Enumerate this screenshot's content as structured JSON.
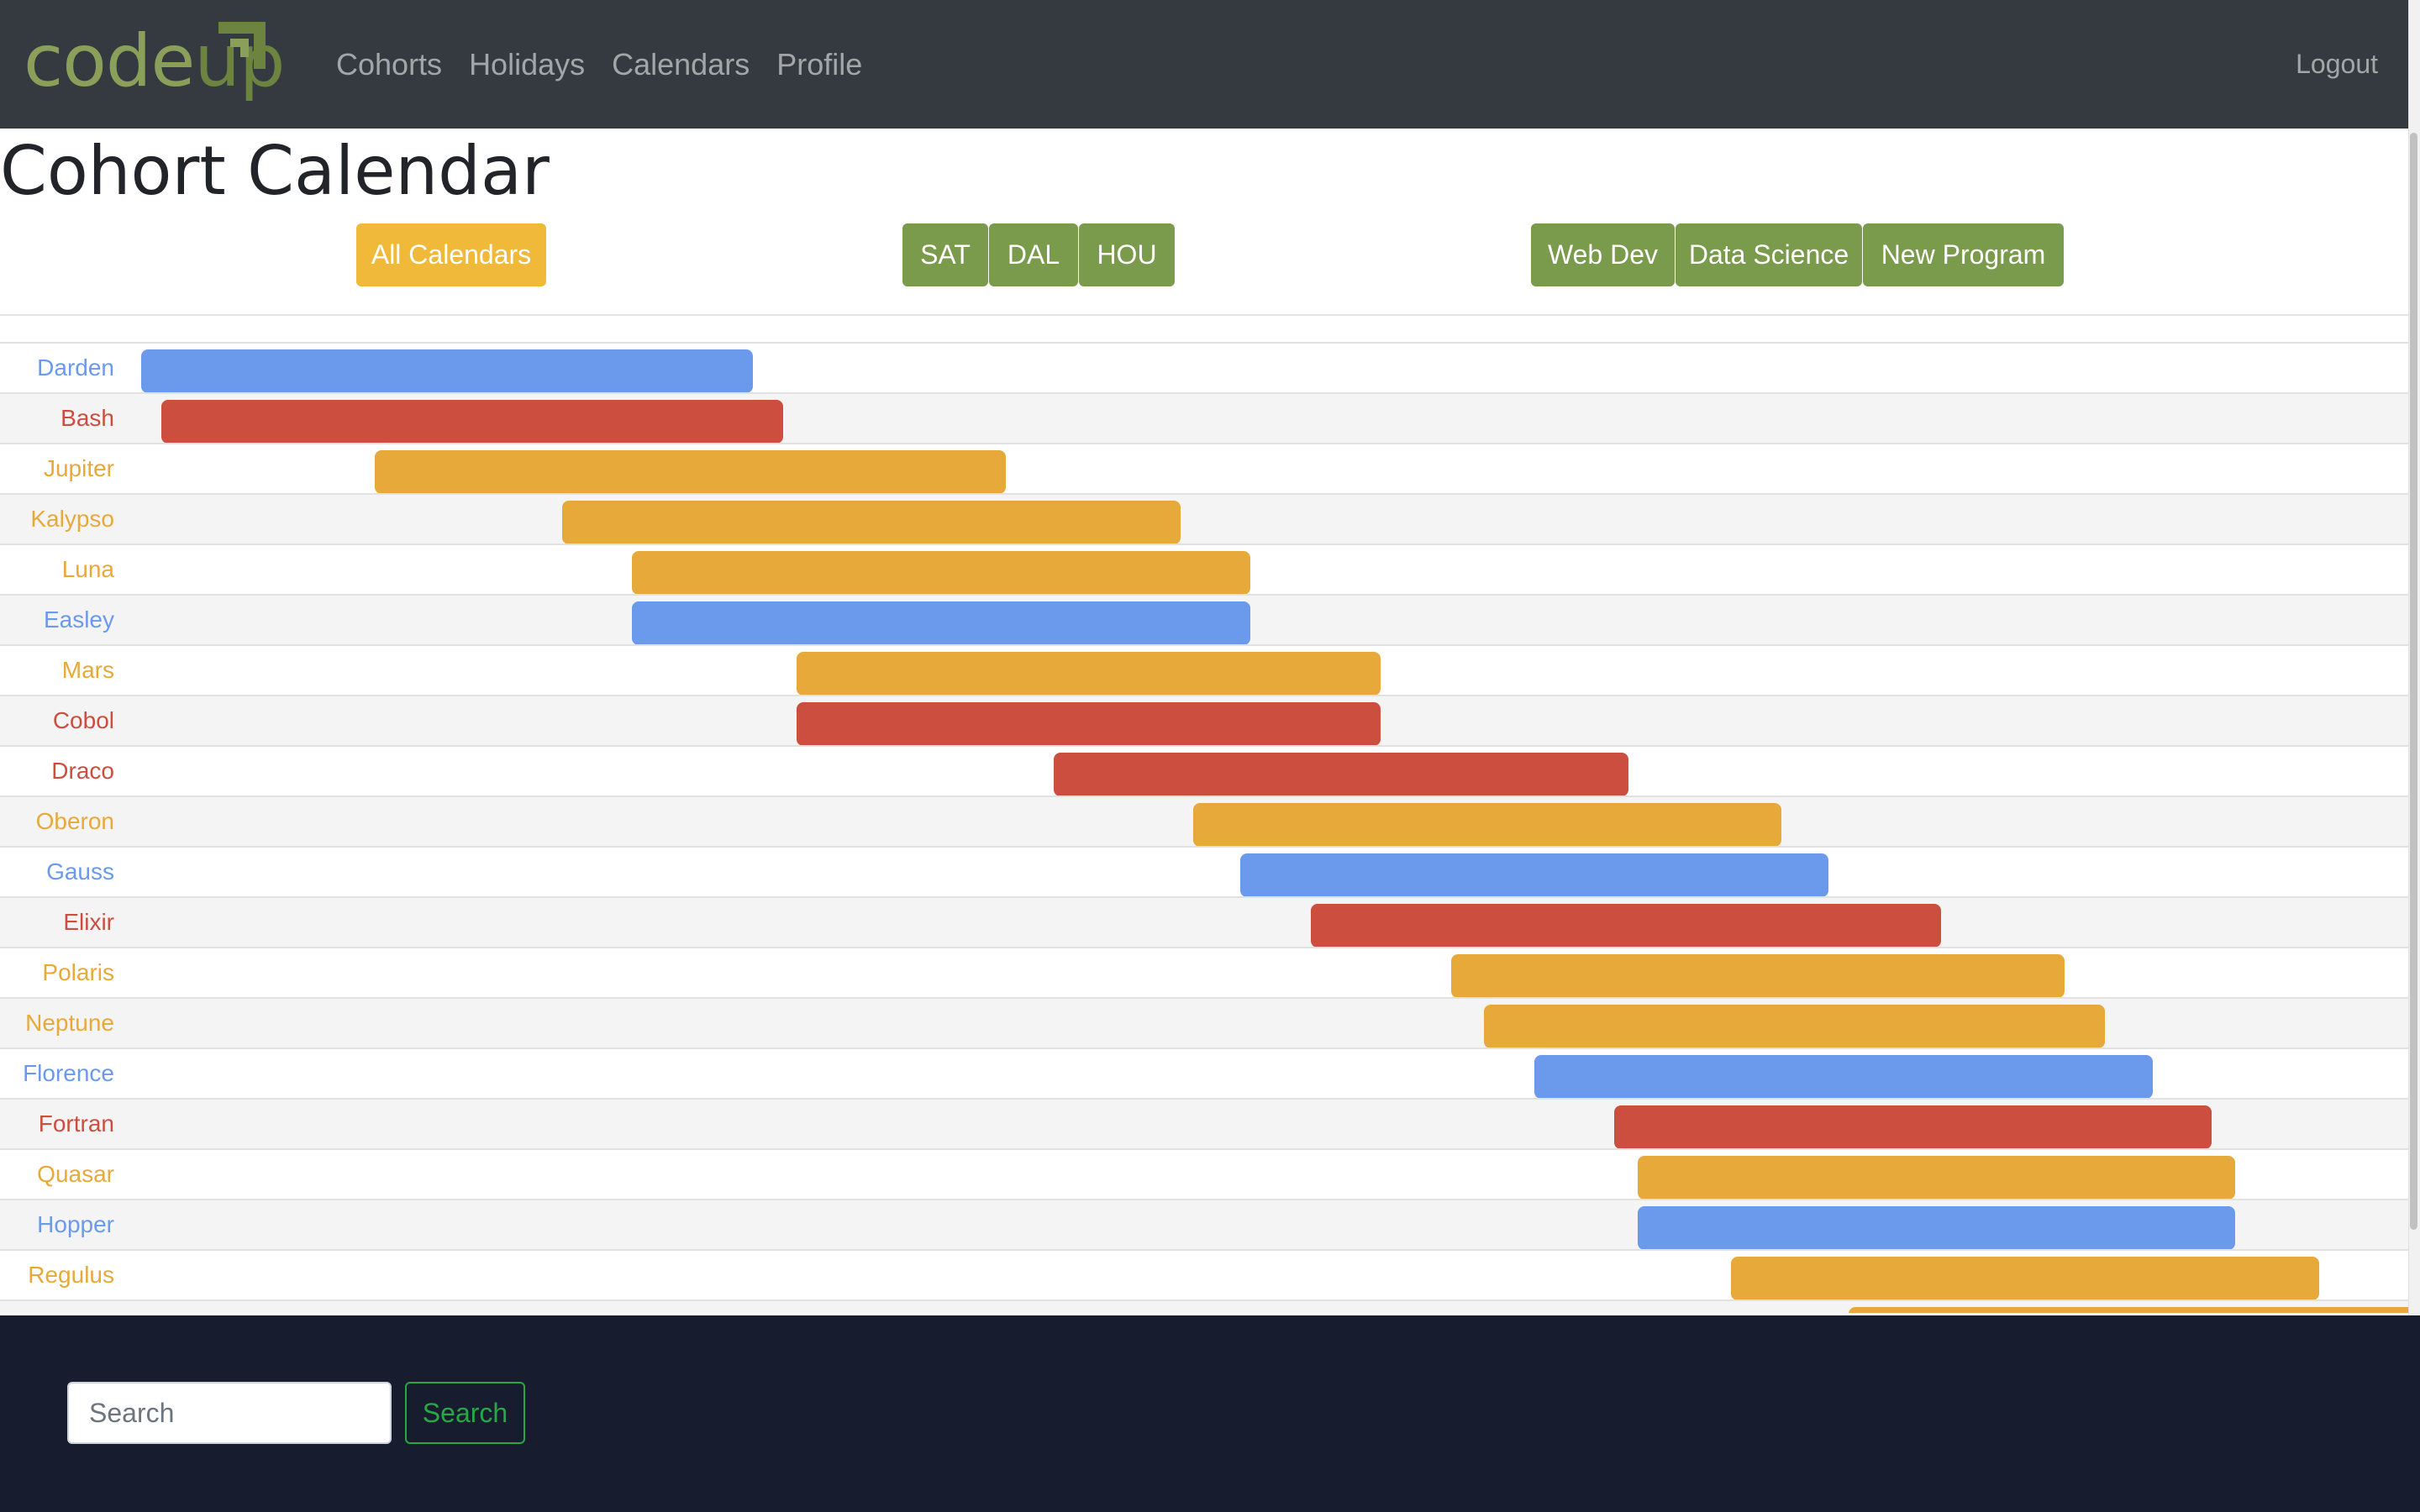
{
  "brand": {
    "part1": "code",
    "part2": "up"
  },
  "nav": {
    "links": [
      {
        "label": "Cohorts"
      },
      {
        "label": "Holidays"
      },
      {
        "label": "Calendars"
      },
      {
        "label": "Profile"
      }
    ],
    "logout": "Logout"
  },
  "page": {
    "title": "Cohort Calendar"
  },
  "filters": {
    "all_label": "All Calendars",
    "locations": [
      "SAT",
      "DAL",
      "HOU"
    ],
    "programs": [
      "Web Dev",
      "Data Science",
      "New Program"
    ]
  },
  "colors": {
    "blue": "#6b9aed",
    "red": "#cc4e3e",
    "gold": "#e8a93b",
    "nav_bg": "#343a40",
    "footer_bg": "#171c2e",
    "btn_gold": "#f0b93a",
    "btn_green": "#7a9a4c"
  },
  "calendar": {
    "cohorts": [
      {
        "name": "Darden",
        "color": "blue"
      },
      {
        "name": "Bash",
        "color": "red"
      },
      {
        "name": "Jupiter",
        "color": "gold"
      },
      {
        "name": "Kalypso",
        "color": "gold"
      },
      {
        "name": "Luna",
        "color": "gold"
      },
      {
        "name": "Easley",
        "color": "blue"
      },
      {
        "name": "Mars",
        "color": "gold"
      },
      {
        "name": "Cobol",
        "color": "red"
      },
      {
        "name": "Draco",
        "color": "red"
      },
      {
        "name": "Oberon",
        "color": "gold"
      },
      {
        "name": "Gauss",
        "color": "blue"
      },
      {
        "name": "Elixir",
        "color": "red"
      },
      {
        "name": "Polaris",
        "color": "gold"
      },
      {
        "name": "Neptune",
        "color": "gold"
      },
      {
        "name": "Florence",
        "color": "blue"
      },
      {
        "name": "Fortran",
        "color": "red"
      },
      {
        "name": "Quasar",
        "color": "gold"
      },
      {
        "name": "Hopper",
        "color": "blue"
      },
      {
        "name": "Regulus",
        "color": "gold"
      },
      {
        "name": "",
        "color": "gold"
      }
    ]
  },
  "footer": {
    "search_placeholder": "Search",
    "search_button": "Search"
  }
}
